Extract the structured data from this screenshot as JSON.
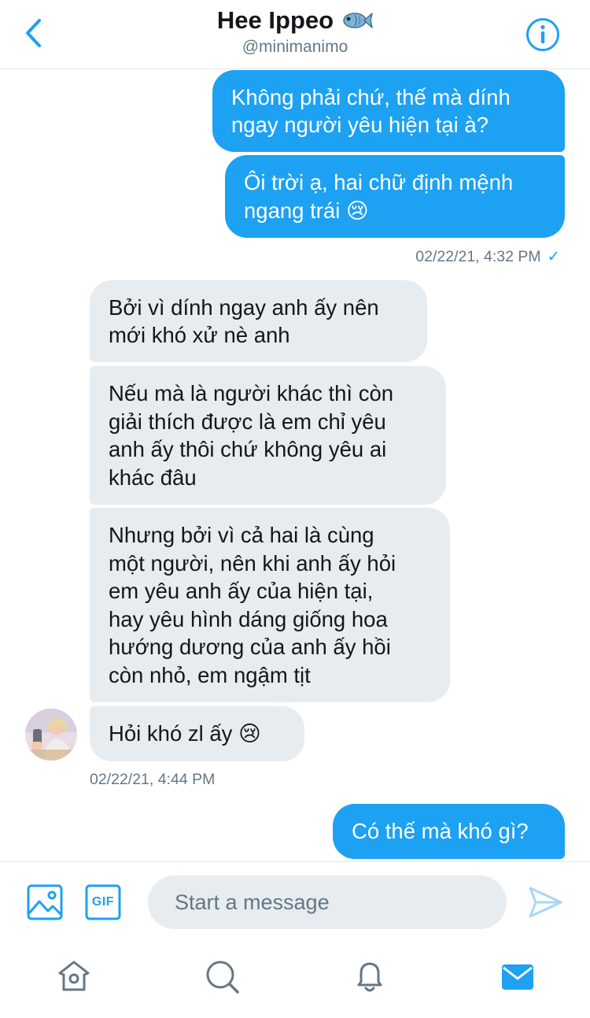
{
  "header": {
    "name": "Hee Ippeo",
    "handle": "@minimanimo"
  },
  "conversation": {
    "sent_1": [
      "Không phải chứ, thế mà dính\nngay người yêu hiện tại à?",
      "Ôi trời ạ, hai chữ định mệnh\nngang trái 😢"
    ],
    "sent_1_timestamp": "02/22/21, 4:32 PM",
    "received": [
      "Bởi vì dính ngay anh ấy nên\nmới khó xử nè anh",
      "Nếu mà là người khác thì còn\ngiải thích được là em chỉ yêu\nanh ấy thôi chứ không yêu ai\nkhác đâu",
      "Nhưng bởi vì cả hai là cùng\nmột người, nên khi anh ấy hỏi\nem yêu anh ấy của hiện tại,\nhay yêu hình dáng giống hoa\nhướng dương của anh ấy hồi\ncòn nhỏ, em ngậm tịt",
      "Hỏi khó zl ấy 😢"
    ],
    "received_timestamp": "02/22/21, 4:44 PM",
    "sent_2": [
      "Có thế mà khó gì?"
    ]
  },
  "composer": {
    "placeholder": "Start a message",
    "gif_label": "GIF"
  },
  "colors": {
    "accent": "#1da1f2",
    "bubble_received": "#e6ecf0",
    "muted_text": "#657786"
  },
  "icons": [
    "back-arrow",
    "fish-emoji",
    "info",
    "image",
    "gif",
    "send",
    "home",
    "search",
    "notifications",
    "messages"
  ]
}
